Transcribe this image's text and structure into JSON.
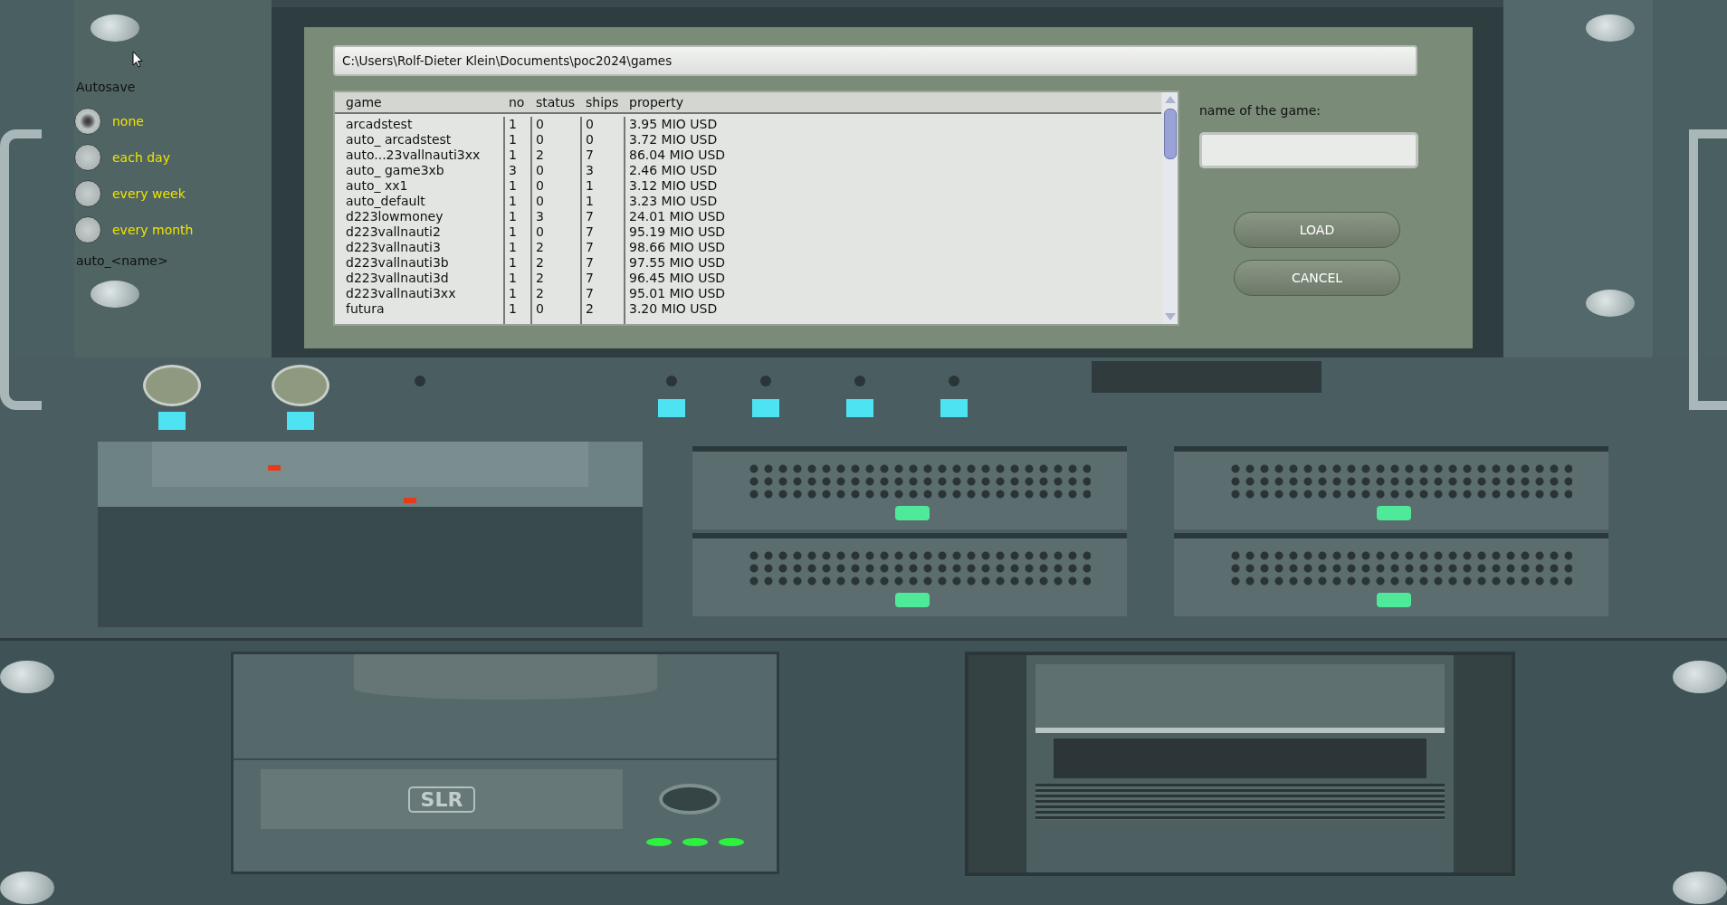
{
  "path": "C:\\Users\\Rolf-Dieter Klein\\Documents\\poc2024\\games",
  "autosave": {
    "title": "Autosave",
    "options": [
      {
        "label": "none",
        "selected": true
      },
      {
        "label": "each day",
        "selected": false
      },
      {
        "label": "every week",
        "selected": false
      },
      {
        "label": "every month",
        "selected": false
      }
    ],
    "pattern": "auto_<name>"
  },
  "table": {
    "columns": [
      "game",
      "no",
      "status",
      "ships",
      "property"
    ],
    "rows": [
      [
        "arcadstest",
        "1",
        "0",
        "0",
        "3.95 MIO USD"
      ],
      [
        "auto_ arcadstest",
        "1",
        "0",
        "0",
        "3.72 MIO USD"
      ],
      [
        "auto...23vallnauti3xx",
        "1",
        "2",
        "7",
        "86.04 MIO USD"
      ],
      [
        "auto_ game3xb",
        "3",
        "0",
        "3",
        "2.46 MIO USD"
      ],
      [
        "auto_ xx1",
        "1",
        "0",
        "1",
        "3.12 MIO USD"
      ],
      [
        "auto_default",
        "1",
        "0",
        "1",
        "3.23 MIO USD"
      ],
      [
        "d223lowmoney",
        "1",
        "3",
        "7",
        "24.01 MIO USD"
      ],
      [
        "d223vallnauti2",
        "1",
        "0",
        "7",
        "95.19 MIO USD"
      ],
      [
        "d223vallnauti3",
        "1",
        "2",
        "7",
        "98.66 MIO USD"
      ],
      [
        "d223vallnauti3b",
        "1",
        "2",
        "7",
        "97.55 MIO USD"
      ],
      [
        "d223vallnauti3d",
        "1",
        "2",
        "7",
        "96.45 MIO USD"
      ],
      [
        "d223vallnauti3xx",
        "1",
        "2",
        "7",
        "95.01 MIO USD"
      ],
      [
        "futura",
        "1",
        "0",
        "2",
        "3.20 MIO USD"
      ]
    ]
  },
  "name_field": {
    "label": "name of the game:"
  },
  "buttons": [
    "LOAD",
    "CANCEL"
  ],
  "slr_drive": {
    "logo": "SLR"
  }
}
